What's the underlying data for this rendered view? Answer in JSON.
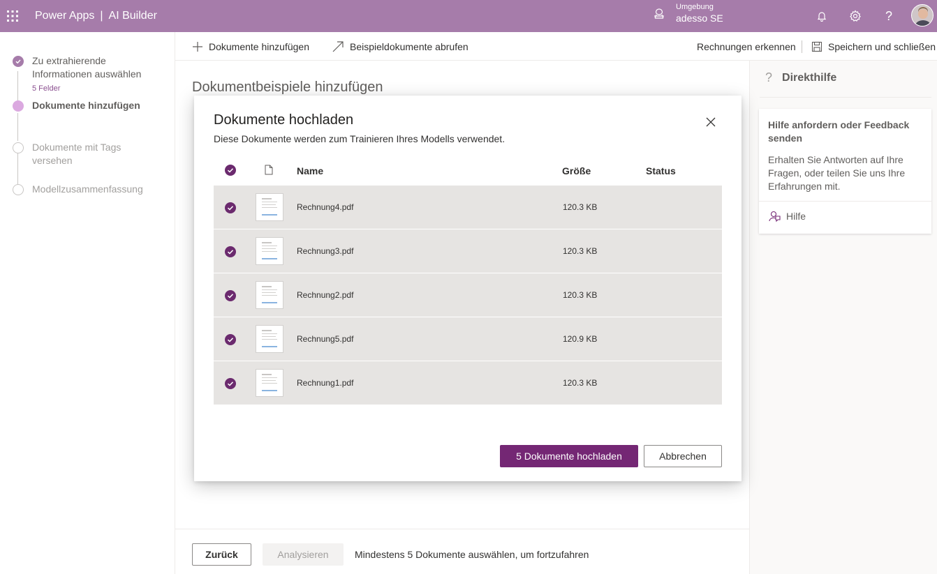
{
  "header": {
    "app_name": "Power Apps",
    "separator": "|",
    "product": "AI Builder",
    "environment_label": "Umgebung",
    "environment_value": "adesso SE"
  },
  "stepper": {
    "steps": [
      {
        "label": "Zu extrahierende Informationen auswählen",
        "sub": "5 Felder",
        "state": "done"
      },
      {
        "label": "Dokumente hinzufügen",
        "state": "current"
      },
      {
        "label": "Dokumente mit Tags versehen",
        "state": "todo"
      },
      {
        "label": "Modellzusammenfassung",
        "state": "todo"
      }
    ]
  },
  "commandbar": {
    "add_documents": "Dokumente hinzufügen",
    "get_samples": "Beispieldokumente abrufen",
    "recognize": "Rechnungen erkennen",
    "save_close": "Speichern und schließen"
  },
  "main": {
    "title": "Dokumentbeispiele hinzufügen"
  },
  "help": {
    "title": "Direkthilfe",
    "card_title": "Hilfe anfordern oder Feedback senden",
    "card_text": "Erhalten Sie Antworten auf Ihre Fragen, oder teilen Sie uns Ihre Erfahrungen mit.",
    "link": "Hilfe"
  },
  "footer": {
    "back": "Zurück",
    "analyze": "Analysieren",
    "hint": "Mindestens 5 Dokumente auswählen, um fortzufahren"
  },
  "dialog": {
    "title": "Dokumente hochladen",
    "subtitle": "Diese Dokumente werden zum Trainieren Ihres Modells verwendet.",
    "columns": {
      "name": "Name",
      "size": "Größe",
      "status": "Status"
    },
    "files": [
      {
        "name": "Rechnung4.pdf",
        "size": "120.3 KB",
        "status": "",
        "selected": true
      },
      {
        "name": "Rechnung3.pdf",
        "size": "120.3 KB",
        "status": "",
        "selected": true
      },
      {
        "name": "Rechnung2.pdf",
        "size": "120.3 KB",
        "status": "",
        "selected": true
      },
      {
        "name": "Rechnung5.pdf",
        "size": "120.9 KB",
        "status": "",
        "selected": true
      },
      {
        "name": "Rechnung1.pdf",
        "size": "120.3 KB",
        "status": "",
        "selected": true
      }
    ],
    "upload_button": "5 Dokumente hochladen",
    "cancel_button": "Abbrechen"
  },
  "colors": {
    "header_bg": "#a67caa",
    "primary": "#742774",
    "check": "#6b2a6e"
  }
}
